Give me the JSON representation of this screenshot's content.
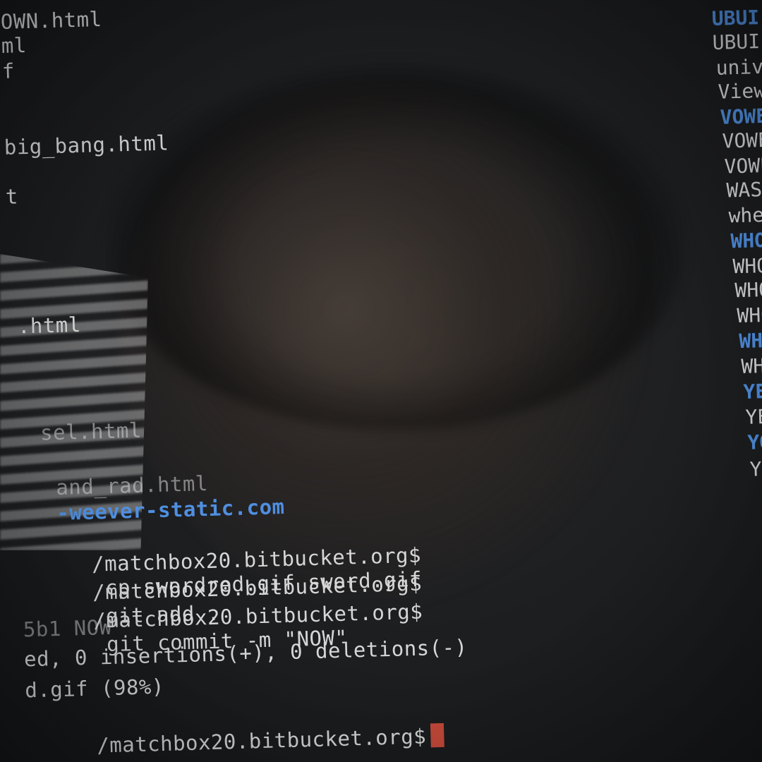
{
  "left_listing": [
    {
      "text": "OWN.html",
      "style": "normal"
    },
    {
      "text": "ml",
      "style": "normal"
    },
    {
      "text": "f",
      "style": "normal"
    },
    {
      "text": "big_bang.html",
      "style": "normal"
    },
    {
      "text": "t",
      "style": "normal"
    },
    {
      "text": ".html",
      "style": "normal"
    },
    {
      "text": "sel.html",
      "style": "dim"
    },
    {
      "text": "and_rad.html",
      "style": "dim"
    },
    {
      "text": "-weever-static.com",
      "style": "blue"
    }
  ],
  "commands": [
    {
      "prompt": "/matchbox20.bitbucket.org$",
      "cmd": "cp swordred.gif sword.gif"
    },
    {
      "prompt": "/matchbox20.bitbucket.org$",
      "cmd": "git add ."
    },
    {
      "prompt": "/matchbox20.bitbucket.org$",
      "cmd": "git commit -m \"NOW\""
    }
  ],
  "output": [
    "5b1 NOW",
    "ed, 0 insertions(+), 0 deletions(-)",
    "d.gif (98%)"
  ],
  "final_prompt": "/matchbox20.bitbucket.org$",
  "right_listing": [
    {
      "text": "UBUI",
      "style": "blue"
    },
    {
      "text": "UBUI",
      "style": "normal"
    },
    {
      "text": "univ",
      "style": "normal"
    },
    {
      "text": "View",
      "style": "normal"
    },
    {
      "text": "VOWE",
      "style": "blue"
    },
    {
      "text": "VOWE",
      "style": "normal"
    },
    {
      "text": "VOWE",
      "style": "normal"
    },
    {
      "text": "WASE",
      "style": "normal"
    },
    {
      "text": "wher",
      "style": "normal"
    },
    {
      "text": "WHO",
      "style": "blue"
    },
    {
      "text": "WHO",
      "style": "normal"
    },
    {
      "text": "WHO",
      "style": "normal"
    },
    {
      "text": "WHO",
      "style": "normal"
    },
    {
      "text": "WHY",
      "style": "blue"
    },
    {
      "text": "WHY",
      "style": "normal"
    },
    {
      "text": "YEA",
      "style": "blue"
    },
    {
      "text": "YE",
      "style": "normal"
    },
    {
      "text": "YO",
      "style": "blue"
    },
    {
      "text": "YO",
      "style": "normal"
    }
  ],
  "colors": {
    "prompt_text": "#d6d6d6",
    "directory_blue": "#4f8fe0",
    "cursor": "#c64a3a",
    "background": "#1b1d1f"
  }
}
